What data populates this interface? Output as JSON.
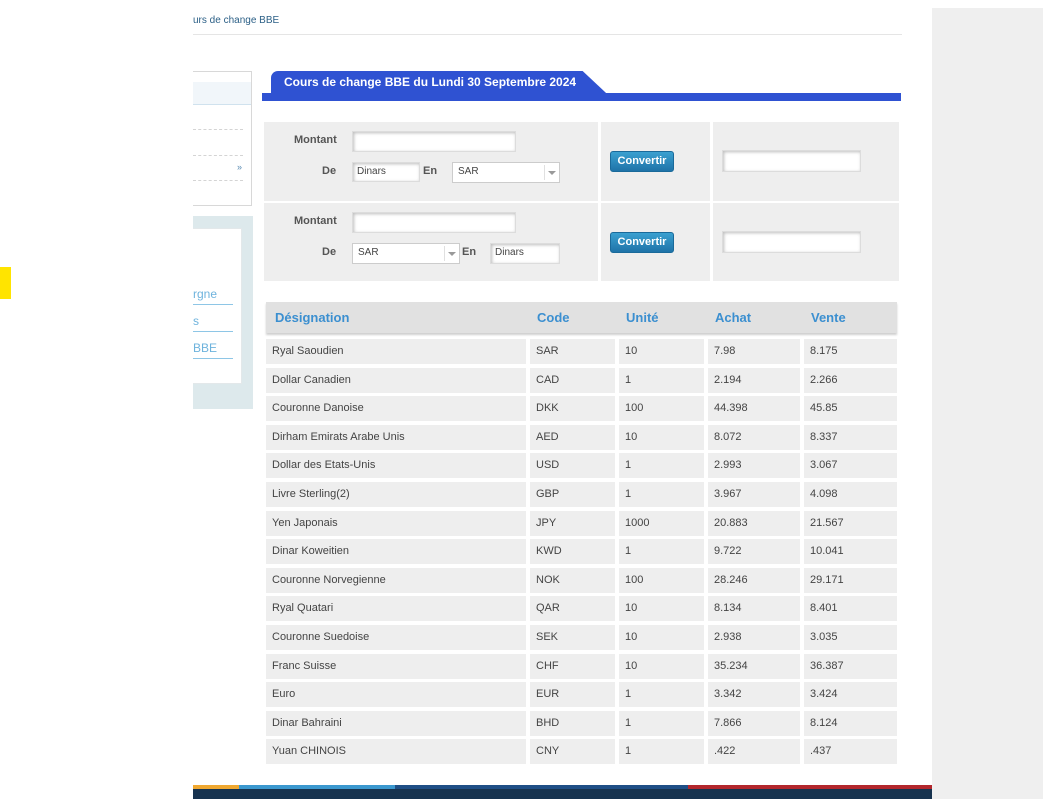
{
  "breadcrumb": "urs de change BBE",
  "sidebar": {
    "links": [
      "rgne",
      "s",
      "BBE"
    ]
  },
  "header": {
    "title": "Cours de change BBE du Lundi 30 Septembre 2024"
  },
  "converter1": {
    "montant_label": "Montant",
    "de_label": "De",
    "en_label": "En",
    "amount_value": "",
    "from_value": "Dinars",
    "to_selected": "SAR",
    "button_label": "Convertir",
    "result_value": ""
  },
  "converter2": {
    "montant_label": "Montant",
    "de_label": "De",
    "en_label": "En",
    "amount_value": "",
    "from_selected": "SAR",
    "to_value": "Dinars",
    "button_label": "Convertir",
    "result_value": ""
  },
  "table": {
    "headers": [
      "Désignation",
      "Code",
      "Unité",
      "Achat",
      "Vente"
    ],
    "rows": [
      [
        "Ryal Saoudien",
        "SAR",
        "10",
        "7.98",
        "8.175"
      ],
      [
        "Dollar Canadien",
        "CAD",
        "1",
        "2.194",
        "2.266"
      ],
      [
        "Couronne Danoise",
        "DKK",
        "100",
        "44.398",
        "45.85"
      ],
      [
        "Dirham Emirats Arabe Unis",
        "AED",
        "10",
        "8.072",
        "8.337"
      ],
      [
        "Dollar des Etats-Unis",
        "USD",
        "1",
        "2.993",
        "3.067"
      ],
      [
        "Livre Sterling(2)",
        "GBP",
        "1",
        "3.967",
        "4.098"
      ],
      [
        "Yen Japonais",
        "JPY",
        "1000",
        "20.883",
        "21.567"
      ],
      [
        "Dinar Koweitien",
        "KWD",
        "1",
        "9.722",
        "10.041"
      ],
      [
        "Couronne Norvegienne",
        "NOK",
        "100",
        "28.246",
        "29.171"
      ],
      [
        "Ryal Quatari",
        "QAR",
        "10",
        "8.134",
        "8.401"
      ],
      [
        "Couronne Suedoise",
        "SEK",
        "10",
        "2.938",
        "3.035"
      ],
      [
        "Franc Suisse",
        "CHF",
        "10",
        "35.234",
        "36.387"
      ],
      [
        "Euro",
        "EUR",
        "1",
        "3.342",
        "3.424"
      ],
      [
        "Dinar Bahraini",
        "BHD",
        "1",
        "7.866",
        "8.124"
      ],
      [
        "Yuan CHINOIS",
        "CNY",
        "1",
        ".422",
        ".437"
      ]
    ]
  },
  "colors": {
    "accent": "#2f52d2",
    "header_text": "#3b8fd0",
    "button": "#1f73a8",
    "footer_dark": "#17334f"
  }
}
